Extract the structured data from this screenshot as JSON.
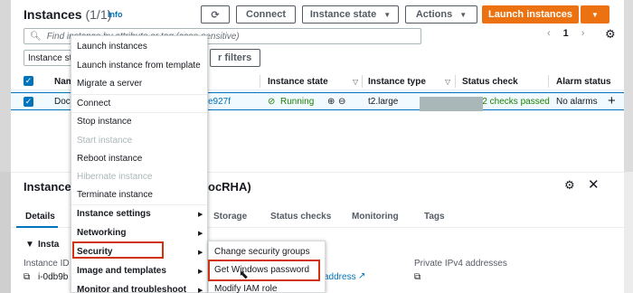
{
  "header": {
    "title": "Instances",
    "count": "(1/1)",
    "info_link": "Info",
    "refresh_icon": "refresh-icon",
    "connect_label": "Connect",
    "instance_state_label": "Instance state",
    "actions_label": "Actions",
    "launch_label": "Launch instances",
    "search_placeholder": "Find instance by attribute or tag (case-sensitive)",
    "pager_page": "1",
    "filter_chip": "Instance st",
    "clear_filters_label": "r filters"
  },
  "table": {
    "columns": [
      "Nam",
      "Instance state",
      "Instance type",
      "Status check",
      "Alarm status"
    ],
    "row": {
      "name": "Doc",
      "instance_id_fragment": "e927f",
      "state": "Running",
      "type": "t2.large",
      "status_check": "2/2 checks passed",
      "alarm": "No alarms",
      "add_symbol": "+"
    }
  },
  "details": {
    "title": "Instance:",
    "title_suffix": "ocRHA)",
    "tabs": [
      "Details",
      "Storage",
      "Status checks",
      "Monitoring",
      "Tags"
    ],
    "section_fragment": "Insta",
    "instance_id_label": "Instance ID",
    "instance_id_value": "i-0db9b",
    "address_link": "address",
    "private_ipv4_label": "Private IPv4 addresses"
  },
  "context_menu": {
    "items": [
      {
        "label": "Launch instances",
        "disabled": false
      },
      {
        "label": "Launch instance from template",
        "disabled": false
      },
      {
        "label": "Migrate a server",
        "disabled": false
      },
      {
        "label": "Connect",
        "disabled": false
      },
      {
        "label": "Stop instance",
        "disabled": false
      },
      {
        "label": "Start instance",
        "disabled": true
      },
      {
        "label": "Reboot instance",
        "disabled": false
      },
      {
        "label": "Hibernate instance",
        "disabled": true
      },
      {
        "label": "Terminate instance",
        "disabled": false
      },
      {
        "label": "Instance settings",
        "disabled": false
      },
      {
        "label": "Networking",
        "disabled": false
      },
      {
        "label": "Security",
        "disabled": false
      },
      {
        "label": "Image and templates",
        "disabled": false
      },
      {
        "label": "Monitor and troubleshoot",
        "disabled": false
      }
    ]
  },
  "security_submenu": {
    "items": [
      "Change security groups",
      "Get Windows password",
      "Modify IAM role"
    ]
  },
  "colors": {
    "accent": "#0073bb",
    "orange": "#ec7211",
    "highlight": "#d13212",
    "running": "#1d8102"
  }
}
